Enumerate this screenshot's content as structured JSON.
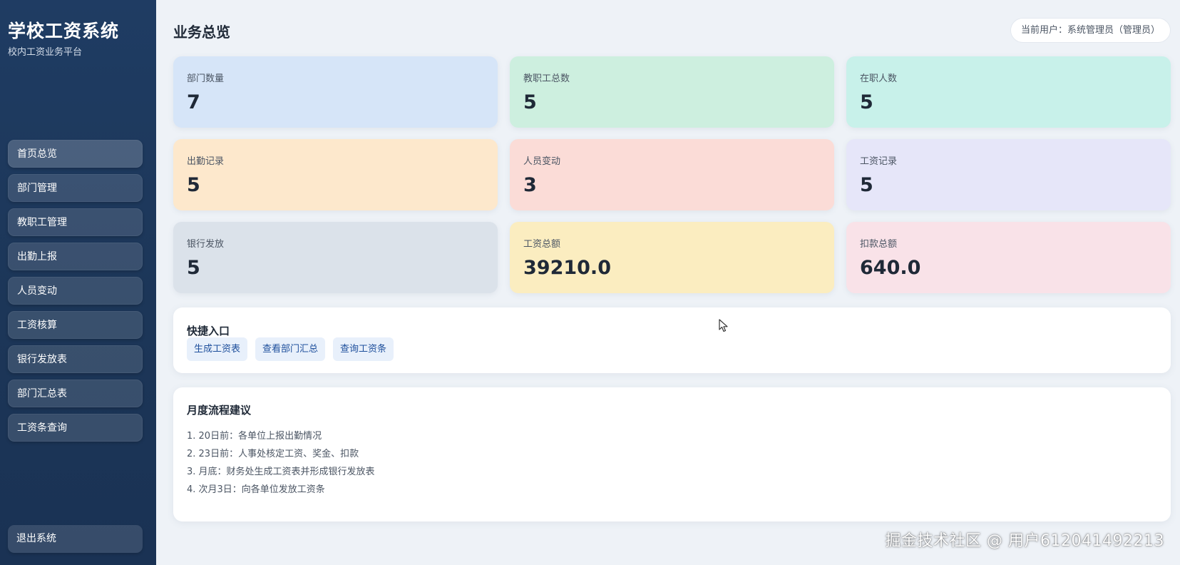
{
  "sidebar": {
    "title": "学校工资系统",
    "subtitle": "校内工资业务平台",
    "items": [
      {
        "label": "首页总览"
      },
      {
        "label": "部门管理"
      },
      {
        "label": "教职工管理"
      },
      {
        "label": "出勤上报"
      },
      {
        "label": "人员变动"
      },
      {
        "label": "工资核算"
      },
      {
        "label": "银行发放表"
      },
      {
        "label": "部门汇总表"
      },
      {
        "label": "工资条查询"
      }
    ],
    "logout": "退出系统"
  },
  "header": {
    "title": "业务总览",
    "current_user": "当前用户：系统管理员（管理员）"
  },
  "stats": [
    {
      "label": "部门数量",
      "value": "7",
      "color": "#d6e5f8"
    },
    {
      "label": "教职工总数",
      "value": "5",
      "color": "#cdefdf"
    },
    {
      "label": "在职人数",
      "value": "5",
      "color": "#c8f1ea"
    },
    {
      "label": "出勤记录",
      "value": "5",
      "color": "#fde8cc"
    },
    {
      "label": "人员变动",
      "value": "3",
      "color": "#fbdcd7"
    },
    {
      "label": "工资记录",
      "value": "5",
      "color": "#e6e6f9"
    },
    {
      "label": "银行发放",
      "value": "5",
      "color": "#dbe2ea"
    },
    {
      "label": "工资总额",
      "value": "39210.0",
      "color": "#fbedc0"
    },
    {
      "label": "扣款总额",
      "value": "640.0",
      "color": "#f9e2e8"
    }
  ],
  "quick": {
    "title": "快捷入口",
    "links": [
      "生成工资表",
      "查看部门汇总",
      "查询工资条"
    ]
  },
  "flow": {
    "title": "月度流程建议",
    "items": [
      "1. 20日前：各单位上报出勤情况",
      "2. 23日前：人事处核定工资、奖金、扣款",
      "3. 月底：财务处生成工资表并形成银行发放表",
      "4. 次月3日：向各单位发放工资条"
    ]
  },
  "watermark": "掘金技术社区 @ 用户612041492213"
}
